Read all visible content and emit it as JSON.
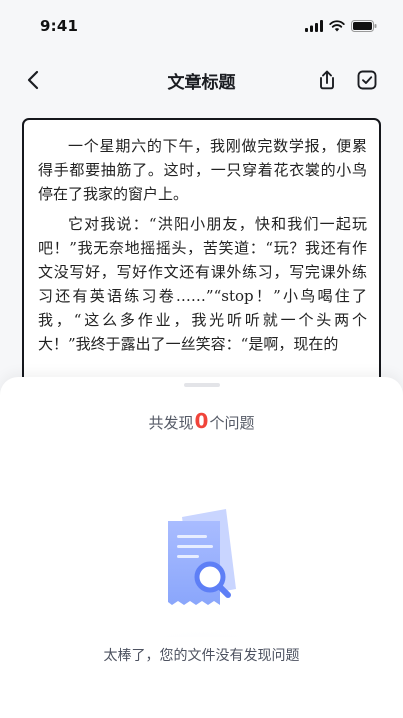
{
  "status_bar": {
    "time": "9:41",
    "icons": [
      "signal-icon",
      "wifi-icon",
      "battery-icon"
    ]
  },
  "nav": {
    "title": "文章标题",
    "icons": [
      "back-arrow-icon",
      "share-icon",
      "check-square-icon"
    ]
  },
  "document": {
    "paragraphs": [
      "一个星期六的下午，我刚做完数学报，便累得手都要抽筋了。这时，一只穿着花衣裳的小鸟停在了我家的窗户上。",
      "它对我说：“洪阳小朋友，快和我们一起玩吧！”我无奈地摇摇头，苦笑道：“玩？我还有作文没写好，写好作文还有课外练习，写完课外练习还有英语练习卷……”“stop！”小鸟喝住了我，“这么多作业，我光听听就一个头两个大！”我终于露出了一丝笑容：“是啊，现在的"
    ]
  },
  "sheet": {
    "header_prefix": "共发现",
    "issue_count": "0",
    "header_suffix": "个问题",
    "empty_message": "太棒了，您的文件没有发现问题",
    "illustration_icon": "document-search-icon"
  },
  "colors": {
    "accent_red": "#f0443a",
    "illustration_blue": "#7d9bfa",
    "card_border": "#15171c"
  }
}
